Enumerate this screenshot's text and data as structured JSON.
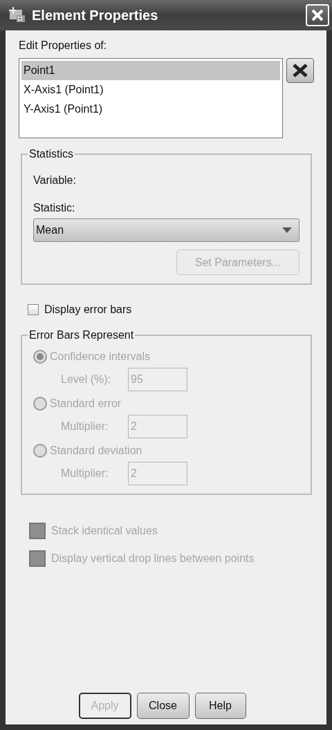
{
  "window": {
    "title": "Element Properties"
  },
  "edit_properties": {
    "label": "Edit Properties of:",
    "items": [
      {
        "text": "Point1",
        "selected": true
      },
      {
        "text": "X-Axis1 (Point1)",
        "selected": false
      },
      {
        "text": "Y-Axis1 (Point1)",
        "selected": false
      }
    ]
  },
  "statistics": {
    "title": "Statistics",
    "variable_label": "Variable:",
    "statistic_label": "Statistic:",
    "statistic_value": "Mean",
    "set_parameters_button": {
      "label": "Set Parameters...",
      "disabled": true
    }
  },
  "display_error_bars": {
    "label": "Display error bars",
    "checked": false
  },
  "error_bars": {
    "title": "Error Bars Represent",
    "options": [
      {
        "label": "Confidence intervals",
        "selected": true,
        "disabled": true,
        "field_label": "Level (%):",
        "field_value": "95"
      },
      {
        "label": "Standard error",
        "selected": false,
        "disabled": true,
        "field_label": "Multiplier:",
        "field_value": "2"
      },
      {
        "label": "Standard deviation",
        "selected": false,
        "disabled": true,
        "field_label": "Multiplier:",
        "field_value": "2"
      }
    ]
  },
  "options": [
    {
      "label": "Stack identical values",
      "checked": false,
      "disabled": true
    },
    {
      "label": "Display vertical drop lines between points",
      "checked": false,
      "disabled": true
    }
  ],
  "buttons": [
    {
      "label": "Apply",
      "disabled": true
    },
    {
      "label": "Close",
      "disabled": false
    },
    {
      "label": "Help",
      "disabled": false
    }
  ]
}
